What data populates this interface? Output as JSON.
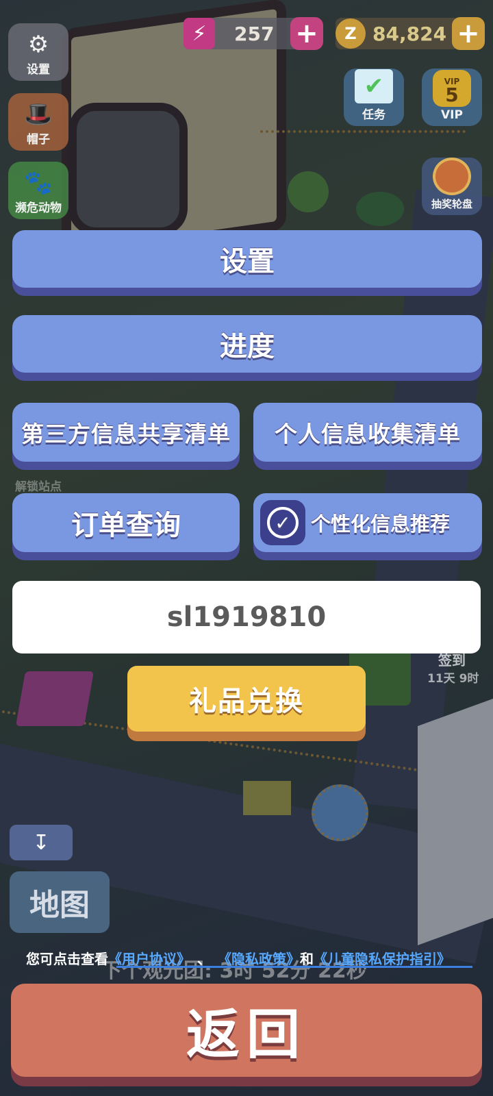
{
  "hud": {
    "energy_value": "257",
    "coins_value": "84,824",
    "coin_symbol": "Z",
    "plus": "+"
  },
  "side_left": [
    {
      "label": "设置",
      "icon": "gear-icon"
    },
    {
      "label": "帽子",
      "icon": "hat-icon"
    },
    {
      "label": "濒危动物",
      "icon": "paw-icon"
    },
    {
      "label": "解锁站点",
      "icon": "unlock-icon"
    }
  ],
  "side_right": [
    {
      "label": "任务",
      "icon": "task-check-icon"
    },
    {
      "label": "VIP",
      "icon": "vip-badge-icon",
      "level": "5",
      "tag": "VIP"
    },
    {
      "label": "抽奖轮盘",
      "icon": "lottery-wheel-icon"
    },
    {
      "label": "签到",
      "icon": "checkin-icon"
    },
    {
      "label": "11天 9时"
    }
  ],
  "menu": {
    "settings_label": "设置",
    "progress_label": "进度",
    "third_party_label": "第三方信息共享清单",
    "personal_info_label": "个人信息收集清单",
    "order_query_label": "订单查询",
    "personalized_label": "个性化信息推荐",
    "personalized_checked": true
  },
  "user_id": "sl1919810",
  "gift_label": "礼品兑换",
  "map": {
    "label": "地图",
    "collapse_icon": "chevron-down-bar-icon"
  },
  "timer_text": "下个观光团: 3时 52分 22秒",
  "policy": {
    "prefix": "您可点击查看",
    "user_agreement": "《用户协议》",
    "sep": "、",
    "privacy_policy": "《隐私政策》",
    "and": "和",
    "child_privacy": "《儿童隐私保护指引》"
  },
  "back_label": "返回",
  "colors": {
    "menu_button": "#7a98e2",
    "menu_shadow": "#4a4f9c",
    "gift_button": "#f2c44c",
    "back_button": "#d07560",
    "link": "#57a8ff"
  }
}
